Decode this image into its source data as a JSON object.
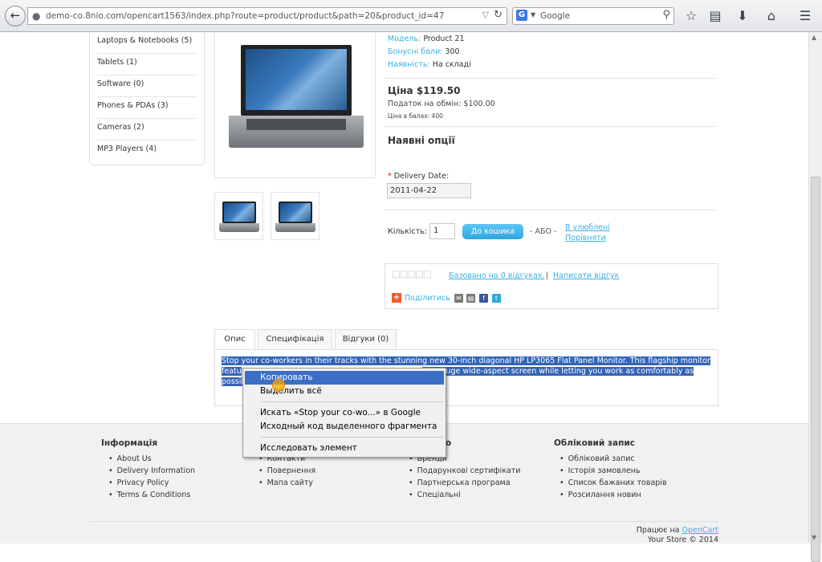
{
  "browser": {
    "url": "demo-co.8nio.com/opencart1563/index.php?route=product/product&path=20&product_id=47",
    "search_engine": "G",
    "search_placeholder": "Google"
  },
  "sidebar": {
    "categories": [
      {
        "label": "Laptops & Notebooks (5)"
      },
      {
        "label": "Tablets (1)"
      },
      {
        "label": "Software (0)"
      },
      {
        "label": "Phones & PDAs (3)"
      },
      {
        "label": "Cameras (2)"
      },
      {
        "label": "MP3 Players (4)"
      }
    ]
  },
  "product": {
    "model_label": "Модель:",
    "model_value": "Product 21",
    "bonus_label": "Бонусні бали:",
    "bonus_value": "300",
    "availability_label": "Наявність:",
    "availability_value": "На складі",
    "price": "Ціна $119.50",
    "ex_tax": "Податок на обмін: $100.00",
    "points_price": "Ціна в балах: 400",
    "options_title": "Наявні опції",
    "required_mark": "*",
    "delivery_label": "Delivery Date:",
    "delivery_value": "2011-04-22",
    "qty_label": "Кількість:",
    "qty_value": "1",
    "cart_button": "До кошика",
    "or_text": "- АБО -",
    "wishlist": "В улюблені",
    "compare": "Порівняти",
    "reviews_link": "Базовано на 0 відгуках.",
    "review_sep": "|",
    "write_review": "Написати відгук",
    "share_label": "Поділитись"
  },
  "tabs": [
    {
      "label": "Опис"
    },
    {
      "label": "Специфікація"
    },
    {
      "label": "Відгуки (0)"
    }
  ],
  "description": {
    "line1": "Stop your co-workers in their tracks with the stunning new 30-inch diagonal HP LP3065 Flat Panel Monitor. This flagship monitor",
    "line2a": "featu",
    "line2b": "on a huge wide-aspect screen while letting you work as comfortably as",
    "line3": "possib"
  },
  "context_menu": {
    "items": [
      {
        "label": "Копировать"
      },
      {
        "label": "Выделить всё"
      },
      {
        "label": "Искать «Stop your co-wo...» в Google"
      },
      {
        "label": "Исходный код выделенного фрагмента"
      },
      {
        "label": "Исследовать элемент"
      }
    ]
  },
  "footer": {
    "col1_title": "Інформація",
    "col1_items": [
      {
        "label": "About Us"
      },
      {
        "label": "Delivery Information"
      },
      {
        "label": "Privacy Policy"
      },
      {
        "label": "Terms & Conditions"
      }
    ],
    "col2_items": [
      {
        "label": "Контакти"
      },
      {
        "label": "Повернення"
      },
      {
        "label": "Мапа сайту"
      }
    ],
    "col3_title_fragment": "о",
    "col3_items": [
      {
        "label": "Бренди"
      },
      {
        "label": "Подарункові сертифікати"
      },
      {
        "label": "Партнерська програма"
      },
      {
        "label": "Спеціальні"
      }
    ],
    "col4_title": "Обліковий запис",
    "col4_items": [
      {
        "label": "Обліковий запис"
      },
      {
        "label": "Історія замовлень"
      },
      {
        "label": "Список бажаних товарів"
      },
      {
        "label": "Розсилання новин"
      }
    ],
    "powered_prefix": "Працює на",
    "powered_link": "OpenCart",
    "copyright": "Your Store © 2014"
  }
}
